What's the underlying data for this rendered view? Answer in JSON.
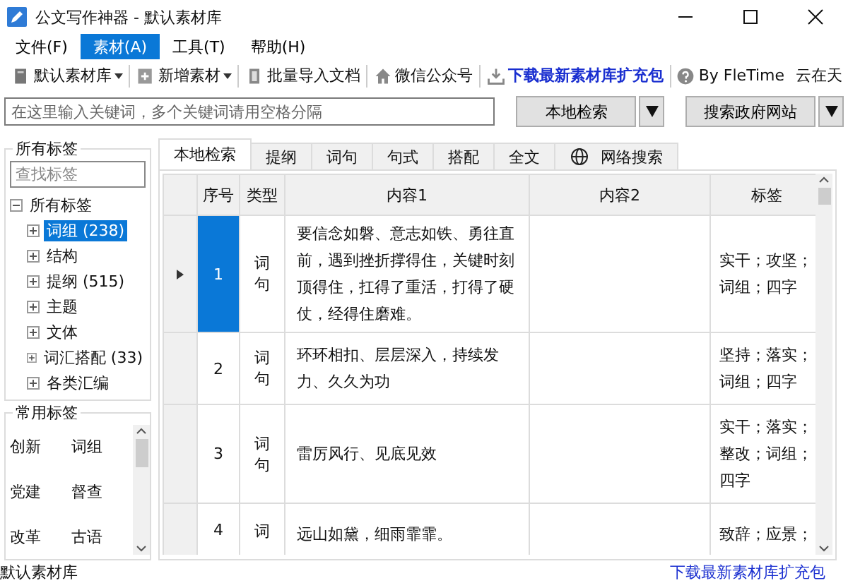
{
  "window": {
    "title": "公文写作神器  -  默认素材库"
  },
  "menu": [
    {
      "label": "文件(F)",
      "selected": false
    },
    {
      "label": "素材(A)",
      "selected": true
    },
    {
      "label": "工具(T)",
      "selected": false
    },
    {
      "label": "帮助(H)",
      "selected": false
    }
  ],
  "toolbar": [
    {
      "label": "默认素材库",
      "kind": "dropdown"
    },
    {
      "label": "新增素材",
      "kind": "dropdown"
    },
    {
      "label": "批量导入文档",
      "kind": "button"
    },
    {
      "label": "微信公众号",
      "kind": "button"
    },
    {
      "label": "下载最新素材库扩充包",
      "kind": "link"
    },
    {
      "label": "By FleTime",
      "kind": "button"
    },
    {
      "label": "云在天",
      "kind": "text"
    }
  ],
  "search": {
    "placeholder": "在这里输入关键词，多个关键词请用空格分隔",
    "buttons": [
      {
        "label": "本地检索"
      },
      {
        "label": "搜索政府网站"
      }
    ]
  },
  "sidebar": {
    "all_tags": {
      "title": "所有标签",
      "filter_placeholder": "查找标签",
      "tree": [
        {
          "label": "所有标签",
          "selected": false,
          "expanded": true,
          "children": [
            {
              "label": "词组 (238)",
              "selected": true,
              "expanded": false
            },
            {
              "label": "结构",
              "selected": false,
              "expanded": false
            },
            {
              "label": "提纲 (515)",
              "selected": false,
              "expanded": false
            },
            {
              "label": "主题",
              "selected": false,
              "expanded": false
            },
            {
              "label": "文体",
              "selected": false,
              "expanded": false
            },
            {
              "label": "词汇搭配 (33)",
              "selected": false,
              "expanded": false
            },
            {
              "label": "各类汇编",
              "selected": false,
              "expanded": false
            }
          ]
        }
      ]
    },
    "common_tags": {
      "title": "常用标签",
      "tags": [
        "创新",
        "词组",
        "党建",
        "督查",
        "改革",
        "古语"
      ]
    }
  },
  "tabs": [
    {
      "label": "本地检索",
      "selected": true
    },
    {
      "label": "提纲",
      "selected": false
    },
    {
      "label": "词句",
      "selected": false
    },
    {
      "label": "句式",
      "selected": false
    },
    {
      "label": "搭配",
      "selected": false
    },
    {
      "label": "全文",
      "selected": false
    },
    {
      "label": "网络搜索",
      "selected": false
    }
  ],
  "table": {
    "columns": [
      "序号",
      "类型",
      "内容1",
      "内容2",
      "标签"
    ],
    "rows": [
      {
        "number": "1",
        "type": "词句",
        "content_1": "要信念如磐、意志如铁、勇往直前，遇到挫折撑得住，关键时刻顶得住，扛得了重活，打得了硬仗，经得住磨难。",
        "tags": "实干；攻坚；词组；四字",
        "selected": true
      },
      {
        "number": "2",
        "type": "词句",
        "content_1": "环环相扣、层层深入，持续发力、久久为功",
        "tags": "坚持；落实；词组；四字",
        "selected": false
      },
      {
        "number": "3",
        "type": "词句",
        "content_1": "雷厉风行、见底见效",
        "tags": "实干；落实；整改；词组；四字",
        "selected": false
      },
      {
        "number": "4",
        "type": "词",
        "content_1": "远山如黛，细雨霏霏。",
        "tags": "致辞；应景；",
        "selected": false
      }
    ]
  },
  "status_bar": {
    "text": "默认素材库",
    "link": "下载最新素材库扩充包"
  }
}
